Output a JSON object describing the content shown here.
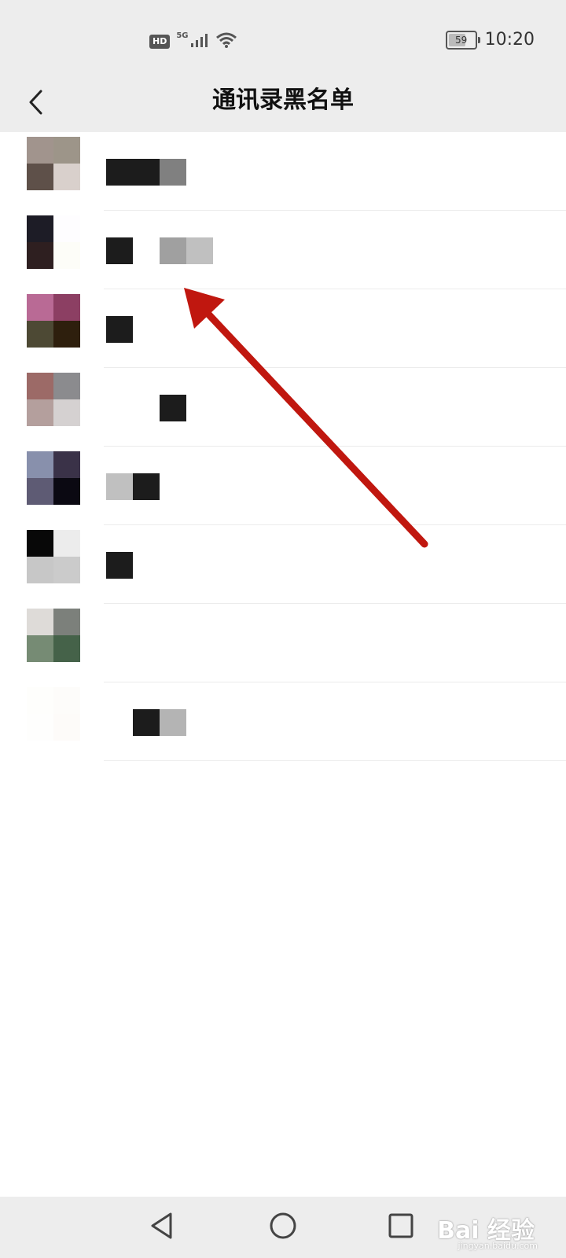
{
  "status_bar": {
    "hd": "HD",
    "network": "5G",
    "battery": "59",
    "battery_level": 0.59,
    "time": "10:20"
  },
  "header": {
    "title": "通讯录黑名单",
    "back_icon": "chevron-left-icon"
  },
  "contacts": [
    {
      "avatar_colors": [
        "#a1948d",
        "#9d9589",
        "#5e5049",
        "#d9d0cc"
      ],
      "name_blocks": [
        "#1c1c1c",
        "#1c1c1c",
        "#808080"
      ]
    },
    {
      "avatar_colors": [
        "#1d1c26",
        "#fefdff",
        "#2e1f20",
        "#fdfdf8"
      ],
      "name_blocks": [
        "#1c1c1c",
        "#ffffff",
        "#a0a0a0",
        "#c0c0c0"
      ]
    },
    {
      "avatar_colors": [
        "#b96a95",
        "#8c3f63",
        "#4d4934",
        "#2e1f0d"
      ],
      "name_blocks": [
        "#1c1c1c"
      ]
    },
    {
      "avatar_colors": [
        "#9c6a67",
        "#8b8b8e",
        "#b49f9d",
        "#d5d1d1"
      ],
      "name_blocks": [
        "#ffffff",
        "#ffffff",
        "#1c1c1c"
      ]
    },
    {
      "avatar_colors": [
        "#8890ac",
        "#3a3248",
        "#5e5b74",
        "#0b0912"
      ],
      "name_blocks": [
        "#c0c0c0",
        "#1c1c1c"
      ]
    },
    {
      "avatar_colors": [
        "#080808",
        "#ececec",
        "#c7c7c7",
        "#cbcbcb"
      ],
      "name_blocks": [
        "#1c1c1c"
      ]
    },
    {
      "avatar_colors": [
        "#dedbd8",
        "#7c807b",
        "#768b74",
        "#456249"
      ],
      "name_blocks": []
    },
    {
      "avatar_colors": [
        "#fefefc",
        "#fdfcfa",
        "#fefefd",
        "#fdfbf9"
      ],
      "name_blocks": [
        "#ffffff",
        "#1c1c1c",
        "#b4b4b4"
      ]
    }
  ],
  "annotation": {
    "arrow_color": "#c0170f"
  },
  "system_nav": {
    "back_icon": "triangle-back-icon",
    "home_icon": "circle-home-icon",
    "recents_icon": "square-recents-icon"
  },
  "watermark": {
    "text": "Bai 经验",
    "sub": "jingyan.baidu.com"
  }
}
